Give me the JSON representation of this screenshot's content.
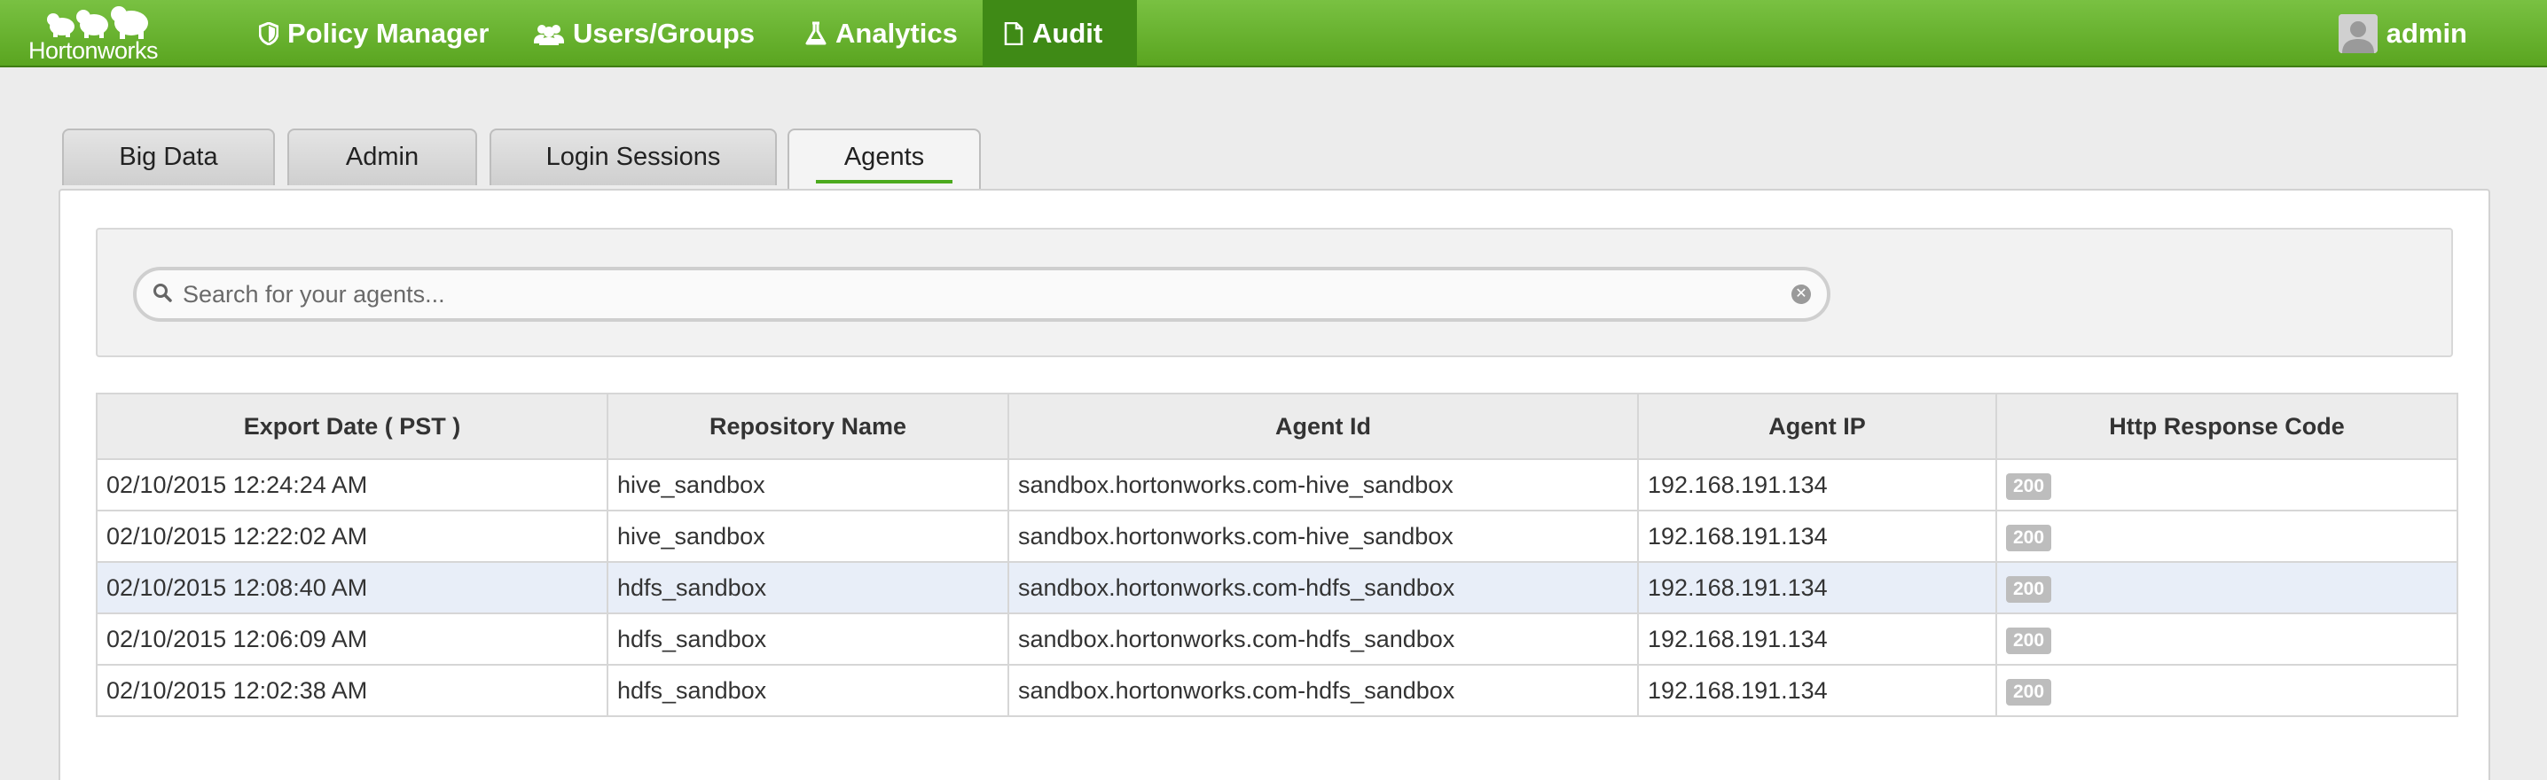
{
  "brand": {
    "name": "Hortonworks"
  },
  "nav": {
    "items": [
      {
        "label": "Policy Manager",
        "icon": "shield-icon"
      },
      {
        "label": "Users/Groups",
        "icon": "users-icon"
      },
      {
        "label": "Analytics",
        "icon": "flask-icon"
      },
      {
        "label": "Audit",
        "icon": "document-icon",
        "active": true
      }
    ],
    "user": {
      "name": "admin",
      "icon": "user-avatar-icon"
    }
  },
  "tabs": [
    {
      "label": "Big Data"
    },
    {
      "label": "Admin"
    },
    {
      "label": "Login Sessions"
    },
    {
      "label": "Agents",
      "active": true
    }
  ],
  "search": {
    "placeholder": "Search for your agents...",
    "value": ""
  },
  "table": {
    "columns": [
      "Export Date ( PST )",
      "Repository Name",
      "Agent Id",
      "Agent IP",
      "Http Response Code"
    ],
    "rows": [
      {
        "export_date": "02/10/2015 12:24:24 AM",
        "repository": "hive_sandbox",
        "agent_id": "sandbox.hortonworks.com-hive_sandbox",
        "agent_ip": "192.168.191.134",
        "http_code": "200"
      },
      {
        "export_date": "02/10/2015 12:22:02 AM",
        "repository": "hive_sandbox",
        "agent_id": "sandbox.hortonworks.com-hive_sandbox",
        "agent_ip": "192.168.191.134",
        "http_code": "200"
      },
      {
        "export_date": "02/10/2015 12:08:40 AM",
        "repository": "hdfs_sandbox",
        "agent_id": "sandbox.hortonworks.com-hdfs_sandbox",
        "agent_ip": "192.168.191.134",
        "http_code": "200",
        "highlighted": true
      },
      {
        "export_date": "02/10/2015 12:06:09 AM",
        "repository": "hdfs_sandbox",
        "agent_id": "sandbox.hortonworks.com-hdfs_sandbox",
        "agent_ip": "192.168.191.134",
        "http_code": "200"
      },
      {
        "export_date": "02/10/2015 12:02:38 AM",
        "repository": "hdfs_sandbox",
        "agent_id": "sandbox.hortonworks.com-hdfs_sandbox",
        "agent_ip": "192.168.191.134",
        "http_code": "200"
      }
    ]
  },
  "colors": {
    "nav_green": "#5aa520",
    "nav_active": "#3f8a16",
    "tab_underline": "#4caa1e",
    "row_highlight": "#e8eef8",
    "badge": "#bdbdbd"
  }
}
